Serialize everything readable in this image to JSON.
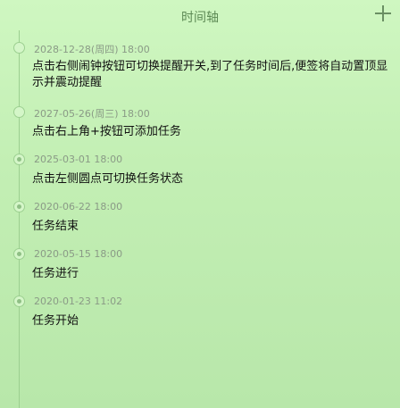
{
  "header": {
    "title": "时间轴",
    "add_icon": "plus-icon"
  },
  "timeline": [
    {
      "date": "2028-12-28(周四) 18:00",
      "text": "点击右侧闹钟按钮可切换提醒开关,到了任务时间后,便签将自动置顶显示并震动提醒",
      "status": "pending"
    },
    {
      "date": "2027-05-26(周三) 18:00",
      "text": "点击右上角+按钮可添加任务",
      "status": "pending"
    },
    {
      "date": "2025-03-01 18:00",
      "text": "点击左侧圆点可切换任务状态",
      "status": "done"
    },
    {
      "date": "2020-06-22 18:00",
      "text": "任务结束",
      "status": "done"
    },
    {
      "date": "2020-05-15 18:00",
      "text": "任务进行",
      "status": "done"
    },
    {
      "date": "2020-01-23 11:02",
      "text": "任务开始",
      "status": "done"
    }
  ],
  "colors": {
    "accent": "#5d8a55",
    "line": "#9ccf90",
    "date": "#8a9a86"
  }
}
